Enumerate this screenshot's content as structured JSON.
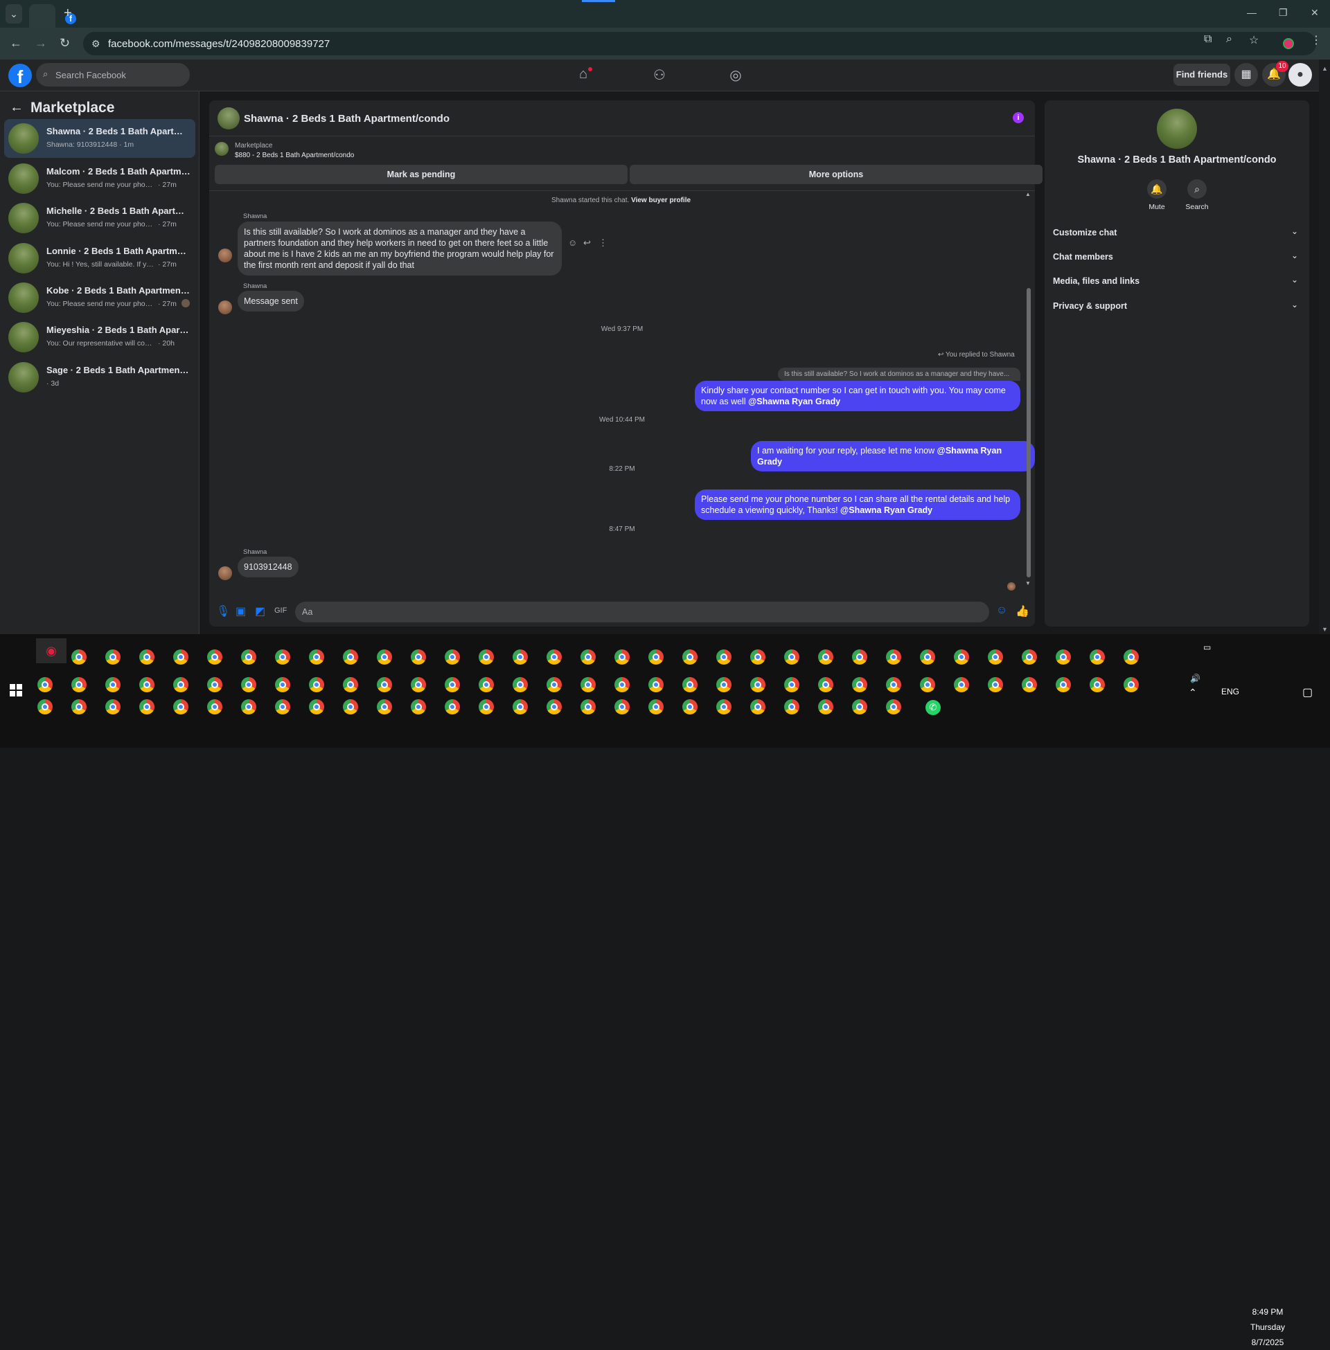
{
  "browser": {
    "url": "facebook.com/messages/t/24098208009839727",
    "new_tab": "+",
    "tab_search": "⌄"
  },
  "facebook": {
    "logo": "f",
    "search_placeholder": "Search Facebook",
    "find_friends": "Find friends",
    "notification_count": "10"
  },
  "left_panel": {
    "title": "Marketplace",
    "conversations": [
      {
        "name": "Shawna · 2 Beds 1 Bath Apartment...",
        "preview": "Shawna: 9103912448 · 1m",
        "time": ""
      },
      {
        "name": "Malcom · 2 Beds 1 Bath Apartment...",
        "preview": "You: Please send me your phone nu...",
        "time": "· 27m"
      },
      {
        "name": "Michelle · 2 Beds 1 Bath Apartmen...",
        "preview": "You: Please send me your phone nu...",
        "time": "· 27m"
      },
      {
        "name": "Lonnie · 2 Beds 1 Bath Apartment/...",
        "preview": "You: Hi ! Yes, still available. If you're i...",
        "time": "· 27m"
      },
      {
        "name": "Kobe · 2 Beds 1 Bath Apartment...",
        "preview": "You: Please send me your phone ...",
        "time": "· 27m"
      },
      {
        "name": "Mieyeshia · 2 Beds 1 Bath Apartme...",
        "preview": "You: Our representative will contact ...",
        "time": "· 20h"
      },
      {
        "name": "Sage · 2 Beds 1 Bath Apartment/co...",
        "preview": "· 3d",
        "time": ""
      }
    ]
  },
  "chat": {
    "title": "Shawna · 2 Beds 1 Bath Apartment/condo",
    "marketplace_label": "Marketplace",
    "listing": "$880 - 2 Beds 1 Bath Apartment/condo",
    "mark_pending": "Mark as pending",
    "more_options": "More options",
    "started_text": "Shawna started this chat.",
    "view_buyer_profile": "View buyer profile",
    "sender_name": "Shawna",
    "msg1": "Is this still available? So I work at dominos as a manager and they have a partners foundation and they help workers in need to get on there feet so a little about me is I have 2 kids an me an my boyfriend the program would help play for the first month rent and deposit if yall do that",
    "msg2": "Message sent",
    "ts1": "Wed 9:37 PM",
    "reply_label": "You replied to Shawna",
    "reply_quote": "Is this still available? So I work at dominos as a manager and they have...",
    "out1": "Kindly share your contact number so I can get in touch with you. You may come now as well",
    "mention": "@Shawna Ryan Grady",
    "ts2": "Wed 10:44 PM",
    "out2": "I am waiting for your reply, please let me know",
    "ts3": "8:22 PM",
    "out3": "Please send me your phone number so I can share all the rental details and help schedule a viewing quickly, Thanks!",
    "ts4": "8:47 PM",
    "msg3": "9103912448",
    "input_placeholder": "Aa"
  },
  "right_panel": {
    "title": "Shawna · 2 Beds 1 Bath Apartment/condo",
    "mute": "Mute",
    "search": "Search",
    "sections": [
      "Customize chat",
      "Chat members",
      "Media, files and links",
      "Privacy & support"
    ]
  },
  "taskbar": {
    "time": "8:49 PM",
    "day": "Thursday",
    "date": "8/7/2025",
    "lang": "ENG"
  },
  "colors": {
    "accent": "#1877f2",
    "outgoing_bubble": "#4c44f0",
    "info_icon": "#a033ff"
  }
}
